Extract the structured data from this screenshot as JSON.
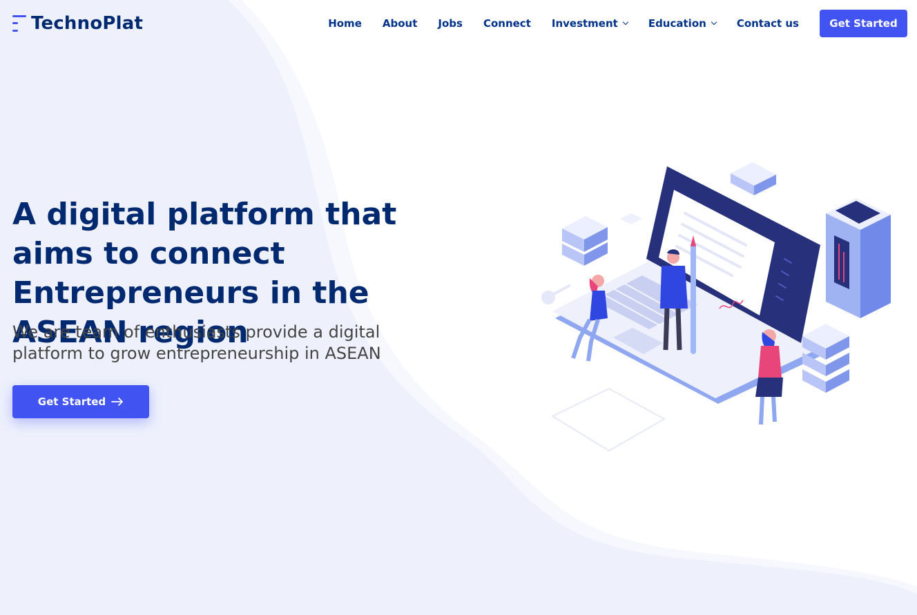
{
  "brand": {
    "name": "TechnoPlat"
  },
  "nav": {
    "items": [
      {
        "label": "Home"
      },
      {
        "label": "About"
      },
      {
        "label": "Jobs"
      },
      {
        "label": "Connect"
      },
      {
        "label": "Investment",
        "dropdown": true
      },
      {
        "label": "Education",
        "dropdown": true
      },
      {
        "label": "Contact us"
      }
    ],
    "cta_label": "Get Started"
  },
  "hero": {
    "title": "A digital platform that aims to connect Entrepreneurs in the ASEAN region",
    "subtitle": "We are team of enthusiasts provide a digital platform to grow entrepreneurship in ASEAN",
    "cta_label": "Get Started",
    "cta_icon": "arrow-right-icon"
  },
  "colors": {
    "accent": "#4154f1",
    "heading": "#012970",
    "nav_text": "#013289",
    "body_text": "#444444",
    "background_wave": "#f0f3fd"
  }
}
